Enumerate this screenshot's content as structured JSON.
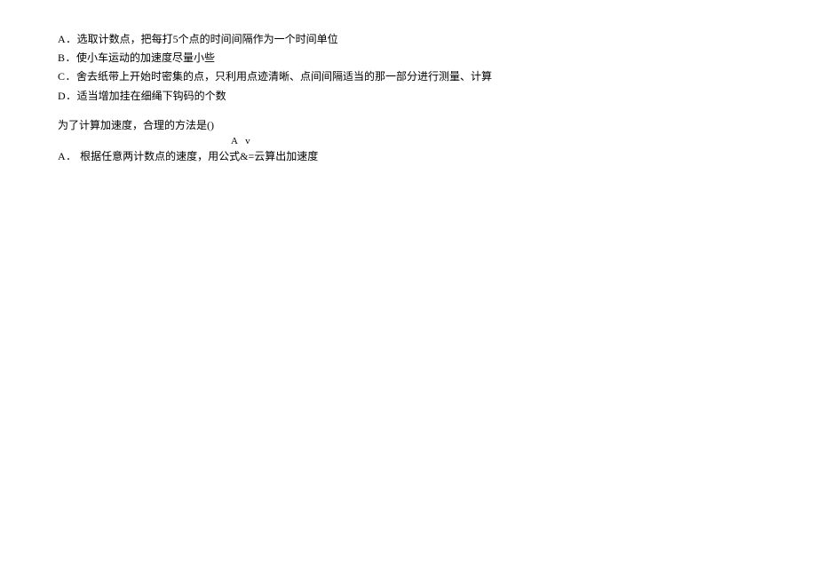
{
  "options1": {
    "a": {
      "label": "A．",
      "text": "选取计数点，把每打5个点的时间间隔作为一个时间单位"
    },
    "b": {
      "label": "B．",
      "text": "使小车运动的加速度尽量小些"
    },
    "c": {
      "label": "C．",
      "text": "舍去纸带上开始时密集的点，只利用点迹清晰、点间间隔适当的那一部分进行测量、计算"
    },
    "d": {
      "label": "D．",
      "text": "适当增加挂在细绳下钩码的个数"
    }
  },
  "question": "为了计算加速度，合理的方法是()",
  "formula": "A v",
  "options2": {
    "a": {
      "label": "A． ",
      "text": "根据任意两计数点的速度，用公式&=云算出加速度"
    }
  }
}
